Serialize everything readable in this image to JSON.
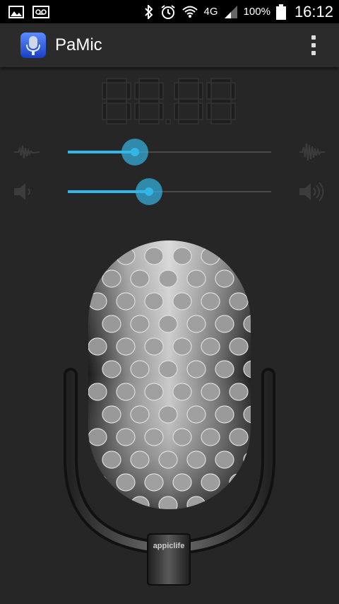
{
  "status_bar": {
    "battery_percent": "100%",
    "time": "16:12",
    "network": "4G",
    "left_icons": [
      "image-icon",
      "voicemail-icon"
    ],
    "right_icons": [
      "bluetooth-icon",
      "alarm-icon",
      "wifi-icon",
      "signal-icon",
      "battery-icon"
    ]
  },
  "app_bar": {
    "title": "PaMic",
    "app_icon": "microphone-app-icon",
    "menu_icon": "overflow-menu-icon"
  },
  "display": {
    "value": "88.88"
  },
  "sliders": [
    {
      "name": "sensitivity",
      "left_icon": "waveform-low-icon",
      "right_icon": "waveform-high-icon",
      "value": 0.33
    },
    {
      "name": "volume",
      "left_icon": "speaker-low-icon",
      "right_icon": "speaker-high-icon",
      "value": 0.4
    }
  ],
  "microphone": {
    "stand_label": "appiclife"
  },
  "colors": {
    "accent": "#33b5e5",
    "background": "#262626",
    "appbar": "#2b2b2b"
  }
}
